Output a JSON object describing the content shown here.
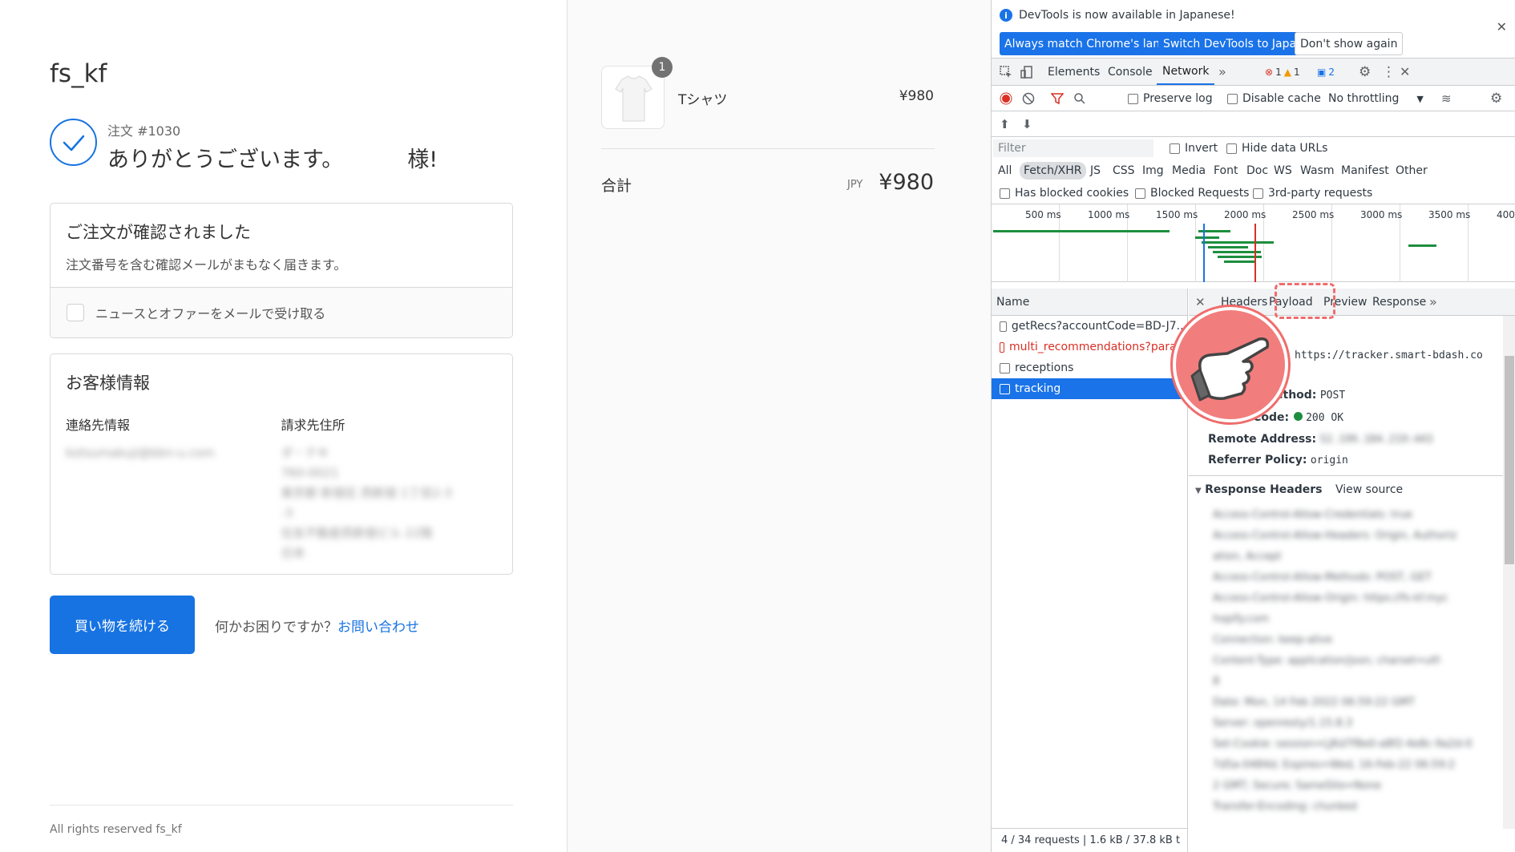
{
  "shop": {
    "store_name": "fs_kf",
    "order_number": "注文 #1030",
    "thanks": "ありがとうございます。",
    "thanks_suffix": "様!",
    "confirm_box": {
      "title": "ご注文が確認されました",
      "subtitle": "注文番号を含む確認メールがまもなく届きます。",
      "newsletter_label": "ニュースとオファーをメールで受け取る"
    },
    "customer_box": {
      "title": "お客様情報",
      "contact_header": "連絡先情報",
      "billing_header": "請求先住所",
      "contact_blurred": "kotsumakuji@bbn-u.com",
      "billing_blurred": [
        "ダ・テキ",
        "760-0021",
        "東京都 新宿区 西新宿 1丁目2-3",
        "-3",
        "住友不動産西新宿ビル 22階",
        "日本"
      ]
    },
    "continue_button": "買い物を続ける",
    "help_text": "何かお困りですか？",
    "contact_link": "お問い合わせ",
    "footer": "All rights reserved fs_kf"
  },
  "summary": {
    "qty_badge": "1",
    "product_name": "Tシャツ",
    "product_price": "¥980",
    "total_label": "合計",
    "currency": "JPY",
    "total_value": "¥980"
  },
  "devtools": {
    "infobar": {
      "message": "DevTools is now available in Japanese!",
      "btn_match": "Always match Chrome's language",
      "btn_switch": "Switch DevTools to Japanese",
      "btn_dont": "Don't show again"
    },
    "tabs": [
      "Elements",
      "Console",
      "Network"
    ],
    "errors_count": "1",
    "warnings_count": "1",
    "messages_count": "2",
    "toolbar": {
      "preserve_log": "Preserve log",
      "disable_cache": "Disable cache",
      "throttling": "No throttling"
    },
    "filter_placeholder": "Filter",
    "invert": "Invert",
    "hide_data_urls": "Hide data URLs",
    "types": [
      "All",
      "Fetch/XHR",
      "JS",
      "CSS",
      "Img",
      "Media",
      "Font",
      "Doc",
      "WS",
      "Wasm",
      "Manifest",
      "Other"
    ],
    "has_blocked_cookies": "Has blocked cookies",
    "blocked_requests": "Blocked Requests",
    "third_party": "3rd-party requests",
    "timeline_ticks": [
      "500 ms",
      "1000 ms",
      "1500 ms",
      "2000 ms",
      "2500 ms",
      "3000 ms",
      "3500 ms",
      "400"
    ],
    "name_header": "Name",
    "requests": [
      {
        "name": "getRecs?accountCode=BD-J7...",
        "state": "normal"
      },
      {
        "name": "multi_recommendations?para...",
        "state": "error"
      },
      {
        "name": "receptions",
        "state": "normal"
      },
      {
        "name": "tracking",
        "state": "selected"
      }
    ],
    "status_bar": "4 / 34 requests  |  1.6 kB / 37.8 kB t",
    "detail_tabs": [
      "Headers",
      "Payload",
      "Preview",
      "Response"
    ],
    "general": {
      "url_value": "https://tracker.smart-bdash.co",
      "method_label": "ethod:",
      "method_value": "POST",
      "status_label": "Status Code:",
      "status_value": "200 OK",
      "remote_label": "Remote Address:",
      "remote_value": "52.199.184.219:443",
      "referrer_label": "Referrer Policy:",
      "referrer_value": "origin"
    },
    "response_headers_title": "Response Headers",
    "view_source": "View source",
    "response_headers_blurred": [
      "Access-Control-Allow-Credentials: true",
      "Access-Control-Allow-Headers: Origin, Authoriz",
      "ation, Accept",
      "Access-Control-Allow-Methods: POST, GET",
      "Access-Control-Allow-Origin: https://fs-kf.myc",
      "hopify.com",
      "Connection: keep-alive",
      "Content-Type: application/json; charset=utf-",
      "8",
      "Date: Mon, 14 Feb 2022 06:59:22 GMT",
      "Server: openresty/1.15.8.3",
      "Set-Cookie: session=LJKd7f8e0-a8f2-4e8c-9a2d-0",
      "7d5a-0484d; Expires=Wed, 16-Feb-22 06:59:2",
      "2 GMT; Secure; SameSite=None",
      "Transfer-Encoding: chunked"
    ]
  }
}
